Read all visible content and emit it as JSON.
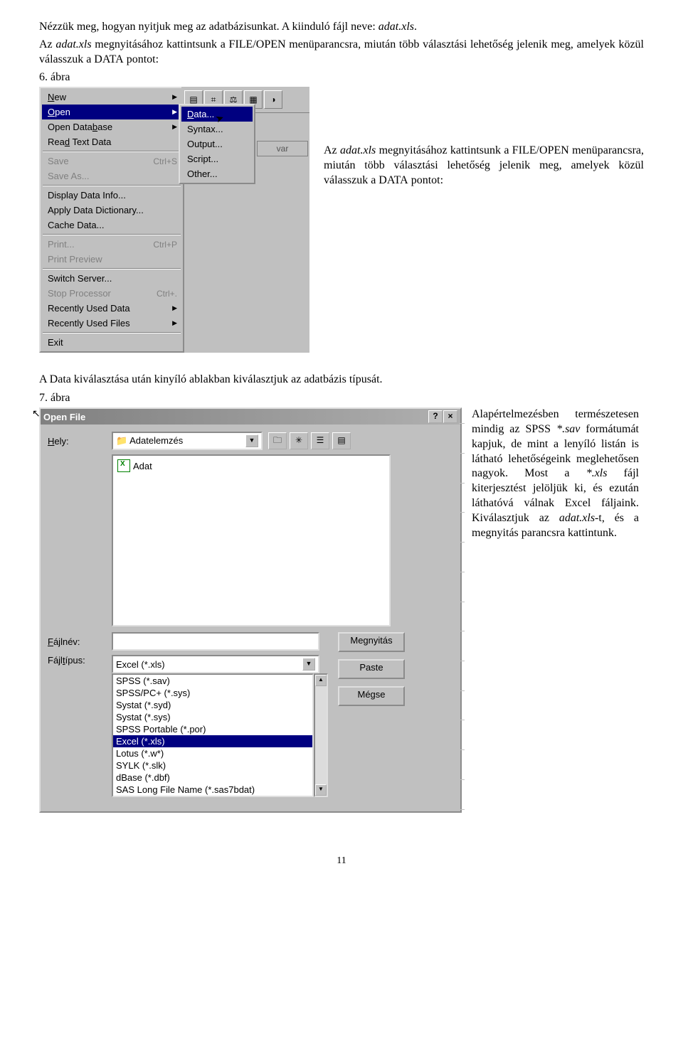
{
  "intro1": "Nézzük meg, hogyan nyitjuk meg az adatbázisunkat. A kiinduló fájl neve: ",
  "intro1_em": "adat.xls",
  "intro1_end": ".",
  "intro2a": "Az ",
  "intro2_em": "adat.xls",
  "intro2b": " megnyitásához kattintsunk a F",
  "intro2c": "/O",
  "intro2d": " menüparancsra, miután több választási lehetőség jelenik meg, amelyek közül válasszuk a D",
  "intro2e": " pontot:",
  "sc_file": "ILE",
  "sc_open": "PEN",
  "sc_data": "ATA",
  "caption6": "6. ábra",
  "caption7": "7. ábra",
  "side1a": "Az ",
  "side1_em": "adat.xls",
  "side1b": " megnyitásához kattintsunk a F",
  "side1c": "/O",
  "side1d": " menüparancsra, miután több választási lehetőség jelenik meg, amelyek közül válasszuk a D",
  "side1e": " pontot:",
  "para3": "A Data kiválasztása után kinyíló ablakban kiválasztjuk az adatbázis típusát.",
  "side2a": "Alapértelmezésben természetesen mindig az SPSS ",
  "side2_em1": "*.sav",
  "side2b": " formátumát kapjuk, de mint a lenyíló listán is látható lehetőségeink meglehetősen nagyok. Most a ",
  "side2_em2": "*.xls",
  "side2c": " fájl kiterjesztést jelöljük ki, és ezután láthatóvá válnak Excel fáljaink. Kiválasztjuk az ",
  "side2_em3": "adat.xls",
  "side2d": "-t, és a megnyitás parancsra kattintunk.",
  "menu": {
    "new": "New",
    "open": "Open",
    "open_db": "Open Database",
    "read_text": "Read Text Data",
    "save": "Save",
    "save_sc": "Ctrl+S",
    "save_as": "Save As...",
    "disp_info": "Display Data Info...",
    "apply_dict": "Apply Data Dictionary...",
    "cache": "Cache Data...",
    "print": "Print...",
    "print_sc": "Ctrl+P",
    "preview": "Print Preview",
    "switch": "Switch Server...",
    "stop": "Stop Processor",
    "stop_sc": "Ctrl+.",
    "recent_data": "Recently Used Data",
    "recent_files": "Recently Used Files",
    "exit": "Exit"
  },
  "submenu": {
    "data": "Data...",
    "syntax": "Syntax...",
    "output": "Output...",
    "script": "Script...",
    "other": "Other..."
  },
  "sheet_var": "var",
  "dlg": {
    "title": "Open File",
    "hely": "Hely:",
    "folder": "Adatelemzés",
    "file": "Adat",
    "fajlnev": "Fájlnév:",
    "fajltipus": "Fájltípus:",
    "type_sel": "Excel (*.xls)",
    "btn_open": "Megnyitás",
    "btn_paste": "Paste",
    "btn_cancel": "Mégse",
    "types": [
      "SPSS (*.sav)",
      "SPSS/PC+ (*.sys)",
      "Systat (*.syd)",
      "Systat (*.sys)",
      "SPSS Portable (*.por)",
      "Excel (*.xls)",
      "Lotus (*.w*)",
      "SYLK (*.slk)",
      "dBase (*.dbf)",
      "SAS Long File Name (*.sas7bdat)"
    ]
  },
  "pagenum": "11"
}
